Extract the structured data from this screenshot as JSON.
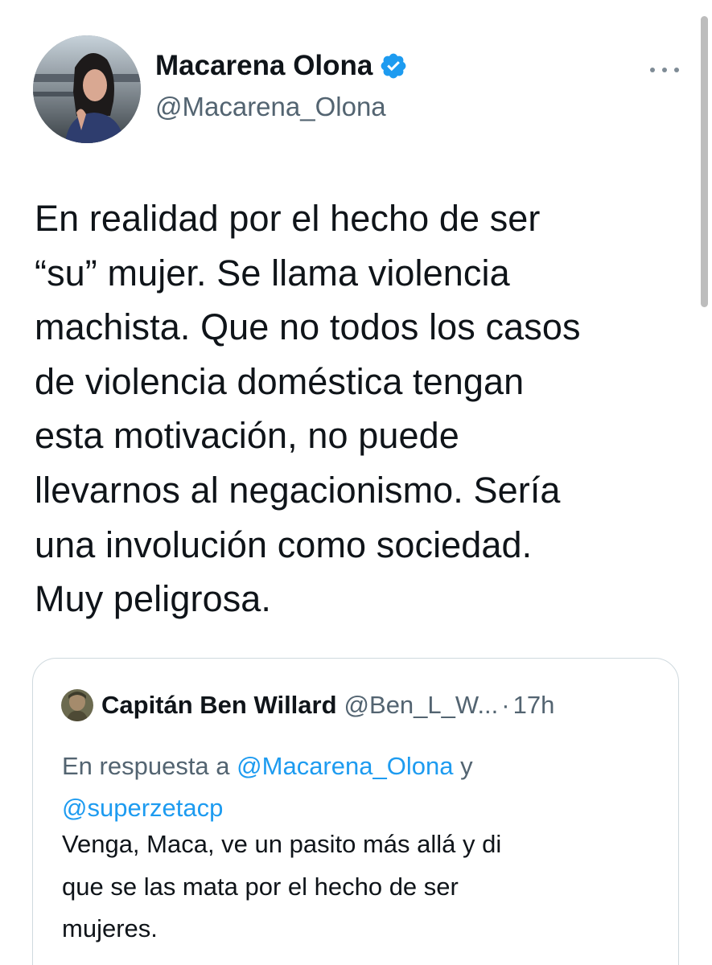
{
  "author": {
    "name": "Macarena Olona",
    "handle": "@Macarena_Olona",
    "verified": true
  },
  "tweet": {
    "text_lines": [
      "En realidad por el hecho de ser",
      "“su” mujer. Se llama violencia",
      "machista. Que no todos los casos",
      "de violencia doméstica tengan",
      "esta motivación, no puede",
      "llevarnos al negacionismo. Sería",
      "una involución como sociedad.",
      "Muy peligrosa."
    ]
  },
  "quoted": {
    "name": "Capitán Ben Willard",
    "handle": "@Ben_L_W...",
    "separator": "·",
    "time": "17h",
    "reply_prefix": "En respuesta a",
    "reply_mention_1": "@Macarena_Olona",
    "reply_conjunction": "y",
    "reply_mention_2": "@superzetacp",
    "text_lines": [
      "Venga, Maca, ve un pasito más allá y di",
      "que se las mata por el hecho de ser",
      "mujeres."
    ]
  },
  "colors": {
    "text": "#0f1419",
    "secondary": "#536471",
    "link": "#1d9bf0",
    "border": "#cfd9de",
    "verified_badge": "#1d9bf0"
  },
  "icons": {
    "verified": "verified-badge-icon",
    "more": "more-options-icon"
  }
}
